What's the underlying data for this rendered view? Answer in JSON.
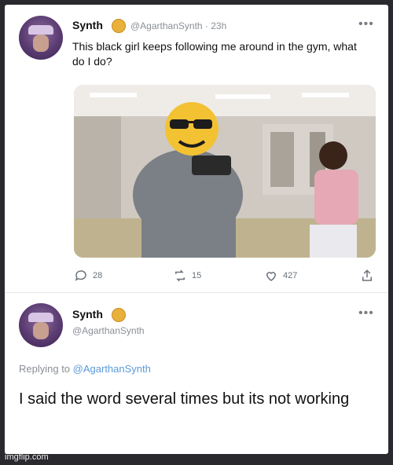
{
  "tweet": {
    "name": "Synth",
    "handle": "@AgarthanSynth",
    "time": "· 23h",
    "more": "•••",
    "text": "This black girl keeps following me around in the gym, what do I do?",
    "actions": {
      "replies": "28",
      "retweets": "15",
      "likes": "427"
    }
  },
  "reply": {
    "name": "Synth",
    "handle": "@AgarthanSynth",
    "more": "•••",
    "replying_label": "Replying to ",
    "replying_to": "@AgarthanSynth",
    "text": "I said the word several times but its not working"
  },
  "watermark": "imgflip.com",
  "colors": {
    "badge": "#e9b13c",
    "mention": "#5b9ad8",
    "background": "#ffffff"
  }
}
